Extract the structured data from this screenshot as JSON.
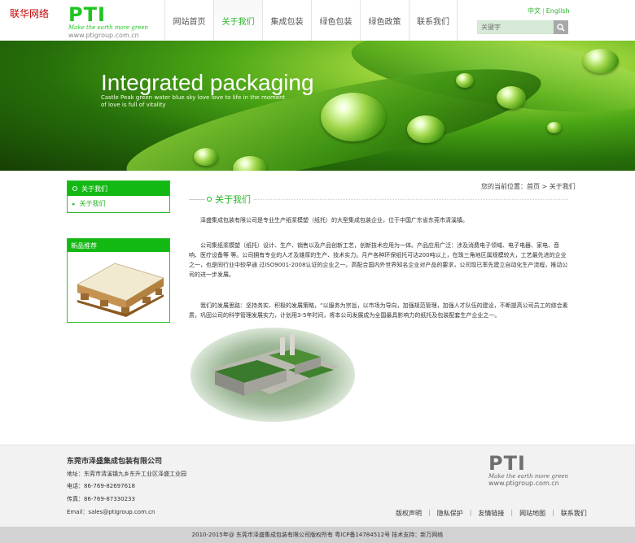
{
  "corner_tag": "联华网络",
  "logo": {
    "name": "PTI",
    "tagline": "Make the earth more green",
    "site": "www.ptigroup.com.cn"
  },
  "nav": [
    "网站首页",
    "关于我们",
    "集成包装",
    "绿色包装",
    "绿色政策",
    "联系我们"
  ],
  "lang": {
    "cn": "中文",
    "sep": "|",
    "en": "English"
  },
  "search": {
    "placeholder": "关键字"
  },
  "banner": {
    "title": "Integrated packaging",
    "subtitle": "Castle Peak green water blue sky love love to life in the moment of love is full of vitality"
  },
  "sidebar": {
    "about_title": "关于我们",
    "about_items": [
      "关于我们"
    ],
    "products_title": "新品推荐"
  },
  "breadcrumb": {
    "prefix": "您的当前位置：",
    "home": "首页",
    "sep": ">",
    "current": "关于我们"
  },
  "section_title": "关于我们",
  "paragraphs": [
    "泽盛集成包装有限公司是专业生产纸浆模塑（纸托）的大型集成包装企业，位于中国广东省东莞市清溪镇。",
    "公司集纸浆模塑（纸托）设计、生产、销售以及产品创新工艺，创新技术应用为一体。产品应用广泛：涉及消费电子领域、电子电器、家电、音响、医疗设备等 等。公司拥有专业的人才及雄厚的生产、技术实力。月产各种环保纸托可达200吨以上，在珠三角地区属规模较大，工艺最先进的企业之一，也是同行业中较早通 过ISO9001-2008认证的企业之一。高配合国内外世界知名企业对产品的要求，公司现已率先建立自动化生产流程，推动公司的进一步发展。",
    "我们的发展思路：坚持务实、积极的发展策略，“以服务为宗旨，以市场为导向，加强规范管理，加强人才队伍的建设，不断提高公司员工的综合素质，巩固公司的科学管理发展实力，计划用3-5年时间，将本公司发展成为全国最具影响力的纸托及包装配套生产企业之一。"
  ],
  "footer": {
    "company": "东莞市泽盛集成包装有限公司",
    "address": "地址：东莞市清溪镇九乡东升工业区泽盛工业园",
    "phone": "电话：86-769-82697618",
    "fax": "传真：86-769-87330233",
    "email": "Email：sales@ptigroup.com.cn",
    "links": [
      "版权声明",
      "隐私保护",
      "友情链接",
      "网站地图",
      "联系我们"
    ],
    "link_sep": "|",
    "logo": {
      "name": "PTI",
      "tagline": "Make the earth more green",
      "site": "www.ptigroup.com.cn"
    }
  },
  "copyright": "2010-2015年@ 东莞市泽盛集成包装有限公司版权所有 粤ICP备14784512号   技术支持：新万网络",
  "colors": {
    "brand_green": "#13b913",
    "accent_green": "#29b529",
    "footer_bg": "#f2f2f2"
  }
}
